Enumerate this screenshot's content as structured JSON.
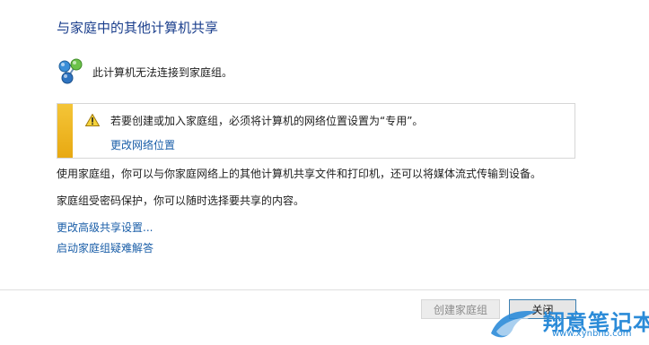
{
  "window": {
    "title": "与家庭中的其他计算机共享"
  },
  "status": {
    "text": "此计算机无法连接到家庭组。",
    "icon": "homegroup-icon"
  },
  "warning": {
    "text": "若要创建或加入家庭组，必须将计算机的网络位置设置为“专用”。",
    "link": "更改网络位置",
    "icon": "warning-icon",
    "accent_color": "#f0b424"
  },
  "description": {
    "line1": "使用家庭组，你可以与你家庭网络上的其他计算机共享文件和打印机，还可以将媒体流式传输到设备。",
    "line2": "家庭组受密码保护，你可以随时选择要共享的内容。"
  },
  "links": {
    "advanced_sharing": "更改高级共享设置...",
    "troubleshooter": "启动家庭组疑难解答"
  },
  "buttons": {
    "create": "创建家庭组",
    "close": "关闭"
  },
  "watermark": {
    "name": "翔意笔记本",
    "url": "www.xynbnb.com"
  }
}
